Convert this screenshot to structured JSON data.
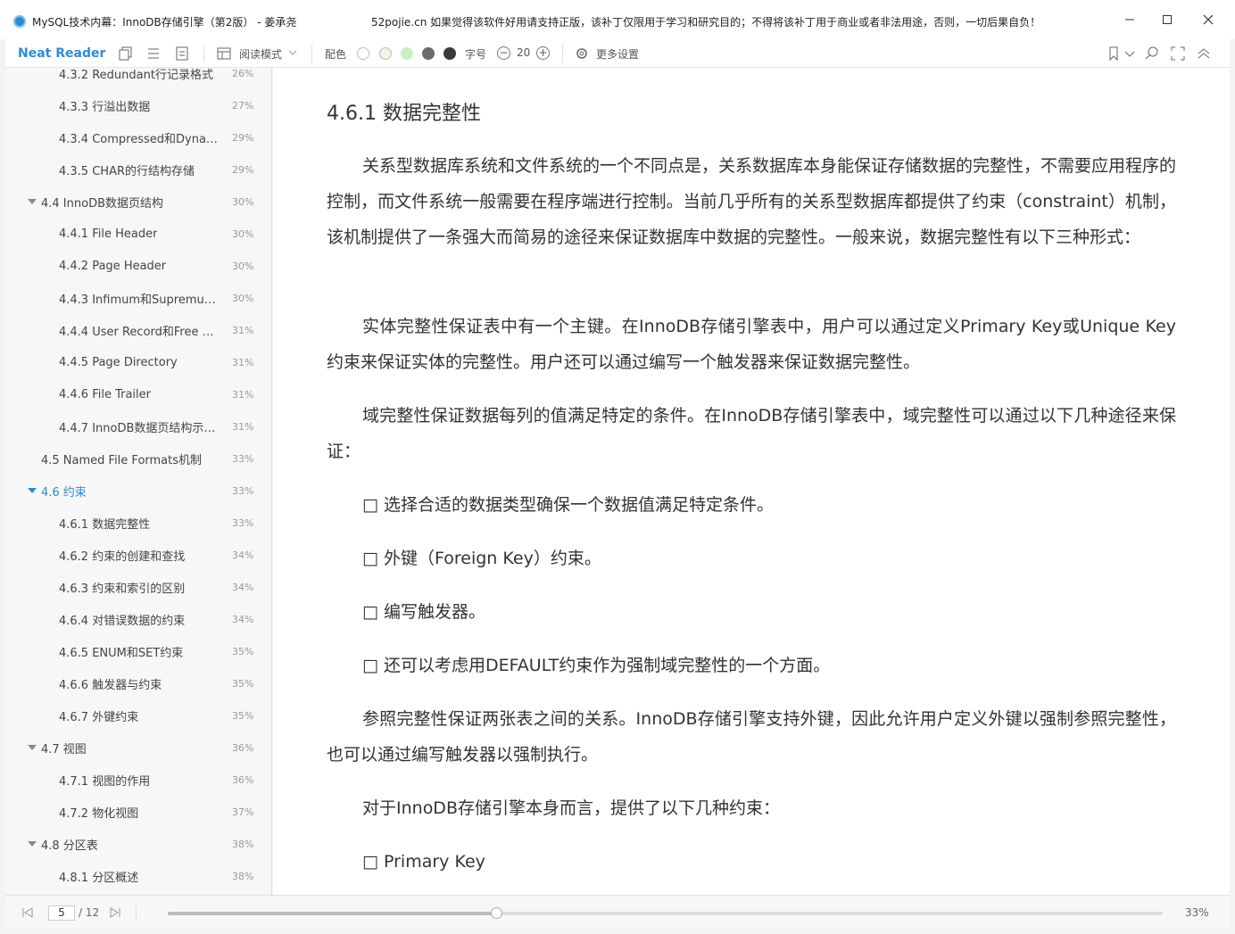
{
  "window": {
    "title": "MySQL技术内幕：InnoDB存储引擎（第2版） - 姜承尧",
    "notice": "52pojie.cn 如果觉得该软件好用请支持正版，该补丁仅限用于学习和研究目的；不得将该补丁用于商业或者非法用途，否则，一切后果自负！"
  },
  "toolbar": {
    "brand": "Neat Reader",
    "reading_mode": "阅读模式",
    "color_label": "配色",
    "font_label": "字号",
    "font_size": "20",
    "more_settings": "更多设置",
    "swatches": [
      "#ffffff",
      "#f1f4e8",
      "#c8efc0",
      "#6b6b6b",
      "#3a3a3a"
    ]
  },
  "toc": [
    {
      "label": "4.3.2 Redundant行记录格式",
      "pct": "26%",
      "level": 2,
      "expanded": false,
      "active": false
    },
    {
      "label": "4.3.3 行溢出数据",
      "pct": "27%",
      "level": 2,
      "expanded": false,
      "active": false
    },
    {
      "label": "4.3.4 Compressed和Dyna…",
      "pct": "29%",
      "level": 2,
      "expanded": false,
      "active": false
    },
    {
      "label": "4.3.5 CHAR的行结构存储",
      "pct": "29%",
      "level": 2,
      "expanded": false,
      "active": false
    },
    {
      "label": "4.4 InnoDB数据页结构",
      "pct": "30%",
      "level": 1,
      "expanded": true,
      "active": false
    },
    {
      "label": "4.4.1 File Header",
      "pct": "30%",
      "level": 2,
      "expanded": false,
      "active": false
    },
    {
      "label": "4.4.2 Page Header",
      "pct": "30%",
      "level": 2,
      "expanded": false,
      "active": false
    },
    {
      "label": "4.4.3 Infimum和Supremu…",
      "pct": "30%",
      "level": 2,
      "expanded": false,
      "active": false
    },
    {
      "label": "4.4.4 User Record和Free …",
      "pct": "31%",
      "level": 2,
      "expanded": false,
      "active": false
    },
    {
      "label": "4.4.5 Page Directory",
      "pct": "31%",
      "level": 2,
      "expanded": false,
      "active": false
    },
    {
      "label": "4.4.6 File Trailer",
      "pct": "31%",
      "level": 2,
      "expanded": false,
      "active": false
    },
    {
      "label": "4.4.7 InnoDB数据页结构示…",
      "pct": "31%",
      "level": 2,
      "expanded": false,
      "active": false
    },
    {
      "label": "4.5 Named File Formats机制",
      "pct": "33%",
      "level": 1,
      "expanded": false,
      "active": false
    },
    {
      "label": "4.6 约束",
      "pct": "33%",
      "level": 1,
      "expanded": true,
      "active": true
    },
    {
      "label": "4.6.1 数据完整性",
      "pct": "33%",
      "level": 2,
      "expanded": false,
      "active": false
    },
    {
      "label": "4.6.2 约束的创建和查找",
      "pct": "34%",
      "level": 2,
      "expanded": false,
      "active": false
    },
    {
      "label": "4.6.3 约束和索引的区别",
      "pct": "34%",
      "level": 2,
      "expanded": false,
      "active": false
    },
    {
      "label": "4.6.4 对错误数据的约束",
      "pct": "34%",
      "level": 2,
      "expanded": false,
      "active": false
    },
    {
      "label": "4.6.5 ENUM和SET约束",
      "pct": "35%",
      "level": 2,
      "expanded": false,
      "active": false
    },
    {
      "label": "4.6.6 触发器与约束",
      "pct": "35%",
      "level": 2,
      "expanded": false,
      "active": false
    },
    {
      "label": "4.6.7 外键约束",
      "pct": "35%",
      "level": 2,
      "expanded": false,
      "active": false
    },
    {
      "label": "4.7 视图",
      "pct": "36%",
      "level": 1,
      "expanded": true,
      "active": false
    },
    {
      "label": "4.7.1 视图的作用",
      "pct": "36%",
      "level": 2,
      "expanded": false,
      "active": false
    },
    {
      "label": "4.7.2 物化视图",
      "pct": "37%",
      "level": 2,
      "expanded": false,
      "active": false
    },
    {
      "label": "4.8 分区表",
      "pct": "38%",
      "level": 1,
      "expanded": true,
      "active": false
    },
    {
      "label": "4.8.1 分区概述",
      "pct": "38%",
      "level": 2,
      "expanded": false,
      "active": false
    }
  ],
  "content": {
    "heading": "4.6.1 数据完整性",
    "p1": "关系型数据库系统和文件系统的一个不同点是，关系数据库本身能保证存储数据的完整性，不需要应用程序的控制，而文件系统一般需要在程序端进行控制。当前几乎所有的关系型数据库都提供了约束（constraint）机制，该机制提供了一条强大而简易的途径来保证数据库中数据的完整性。一般来说，数据完整性有以下三种形式：",
    "p2": "实体完整性保证表中有一个主键。在InnoDB存储引擎表中，用户可以通过定义Primary Key或Unique Key约束来保证实体的完整性。用户还可以通过编写一个触发器来保证数据完整性。",
    "p3": "域完整性保证数据每列的值满足特定的条件。在InnoDB存储引擎表中，域完整性可以通过以下几种途径来保证：",
    "b1": "□ 选择合适的数据类型确保一个数据值满足特定条件。",
    "b2": "□ 外键（Foreign Key）约束。",
    "b3": "□ 编写触发器。",
    "b4": "□ 还可以考虑用DEFAULT约束作为强制域完整性的一个方面。",
    "p4": "参照完整性保证两张表之间的关系。InnoDB存储引擎支持外键，因此允许用户定义外键以强制参照完整性，也可以通过编写触发器以强制执行。",
    "p5": "对于InnoDB存储引擎本身而言，提供了以下几种约束：",
    "b5": "□ Primary Key"
  },
  "footer": {
    "page": "5",
    "total": "/ 12",
    "progress_pct": "33%",
    "progress": 0.33
  }
}
